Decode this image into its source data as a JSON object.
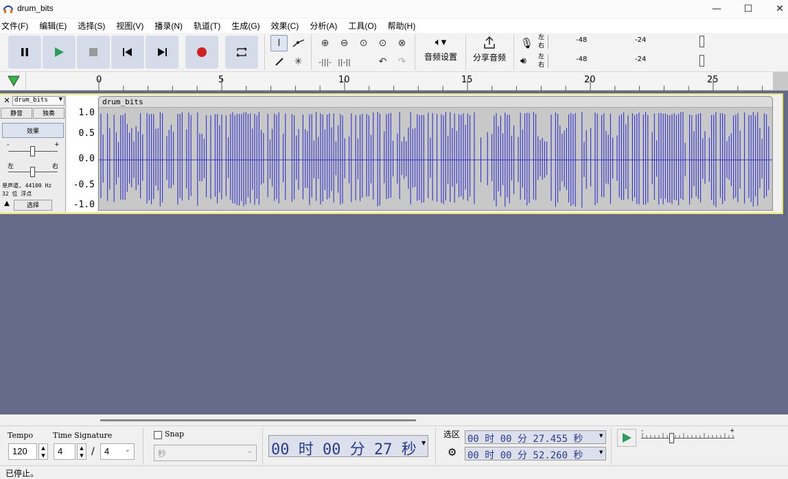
{
  "window": {
    "title": "drum_bits",
    "minimize": "—",
    "maximize": "☐",
    "close": "✕"
  },
  "menu": [
    "文件(F)",
    "编辑(E)",
    "选择(S)",
    "视图(V)",
    "播录(N)",
    "轨道(T)",
    "生成(G)",
    "效果(C)",
    "分析(A)",
    "工具(O)",
    "帮助(H)"
  ],
  "toolbar": {
    "audio_setup": "音频设置",
    "share_audio": "分享音频",
    "meter_left": "左",
    "meter_right": "右",
    "meter_ticks": [
      "-48",
      "-24"
    ]
  },
  "ruler": {
    "labels": [
      "0",
      "5",
      "10",
      "15",
      "20",
      "25"
    ]
  },
  "track": {
    "name": "drum_bits",
    "mute": "静音",
    "solo": "独奏",
    "effects": "效果",
    "gain_minus": "-",
    "gain_plus": "+",
    "pan_left": "左",
    "pan_right": "右",
    "info_line1": "单声道, 44100 Hz",
    "info_line2": "32 位 浮点",
    "select": "选择",
    "clip_name": "drum_bits",
    "y_labels": [
      "1.0",
      "0.5",
      "0.0",
      "-0.5",
      "-1.0"
    ]
  },
  "bottom": {
    "tempo_label": "Tempo",
    "tempo_value": "120",
    "timesig_label": "Time Signature",
    "timesig_num": "4",
    "timesig_slash": "/",
    "timesig_den": "4",
    "snap_label": "Snap",
    "snap_unit": "秒",
    "time_display": "00 时 00 分 27 秒",
    "selection_label": "选区",
    "sel_start": "00 时 00 分 27.455 秒",
    "sel_end": "00 时 00 分 52.260 秒",
    "speed_minus": "-",
    "speed_plus": "+"
  },
  "status": "已停止。",
  "colors": {
    "wave": "#3232c8",
    "track_bg": "#656a88",
    "selected_border": "#e8e86a"
  }
}
